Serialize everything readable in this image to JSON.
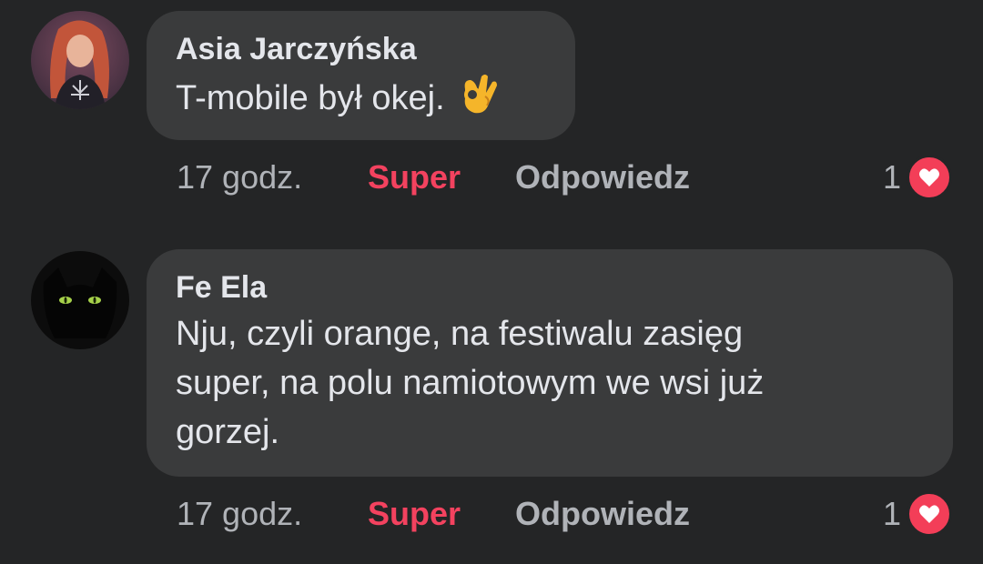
{
  "comments": [
    {
      "author": "Asia Jarczyńska",
      "text": "T-mobile był okej.",
      "emoji": "ok-hand",
      "time": "17 godz.",
      "like_label": "Super",
      "reply_label": "Odpowiedz",
      "reaction_count": "1",
      "reaction_icon": "heart-icon"
    },
    {
      "author": "Fe Ela",
      "text": "Nju, czyli orange, na festiwalu zasięg\nsuper, na polu namiotowym we wsi już\ngorzej.",
      "time": "17 godz.",
      "like_label": "Super",
      "reply_label": "Odpowiedz",
      "reaction_count": "1",
      "reaction_icon": "heart-icon"
    }
  ],
  "colors": {
    "background": "#242526",
    "bubble": "#3a3b3c",
    "primary_text": "#e4e6eb",
    "secondary_text": "#b0b3b8",
    "super_accent": "#f3425f",
    "heart_badge": "#f33e58"
  }
}
